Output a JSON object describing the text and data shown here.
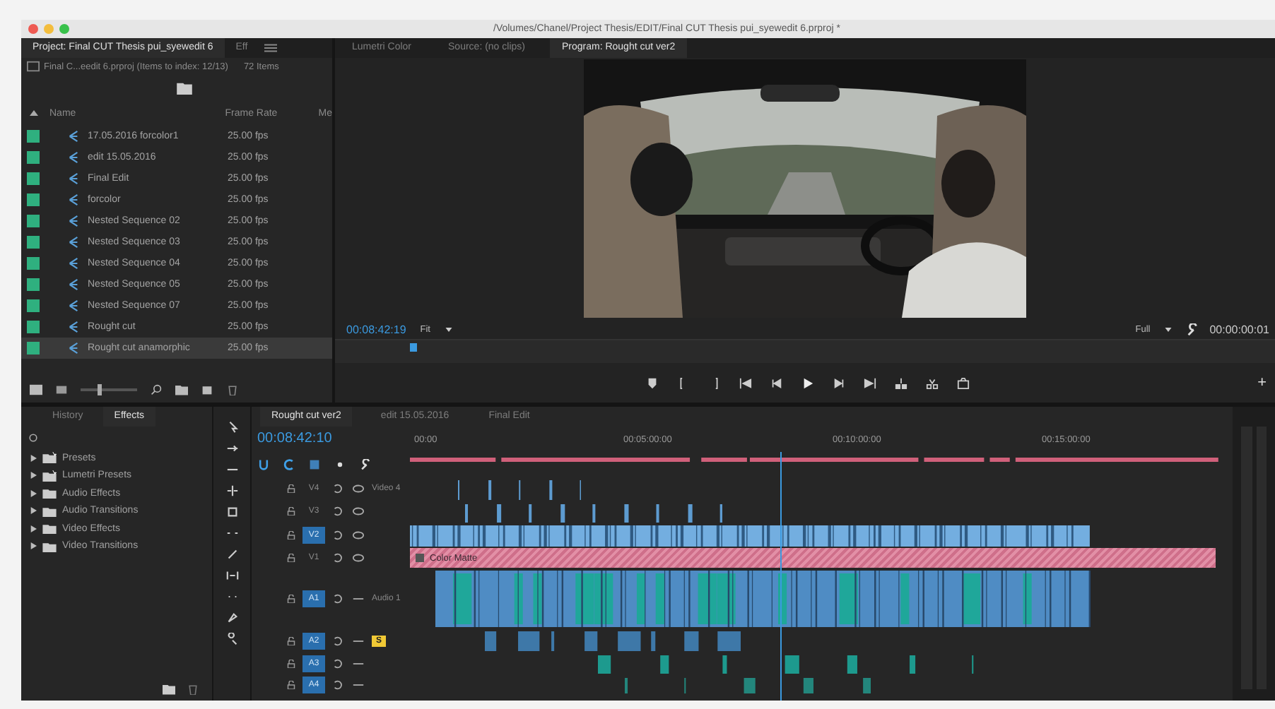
{
  "window": {
    "title": "/Volumes/Chanel/Project Thesis/EDIT/Final CUT Thesis pui_syewedit 6.prproj *"
  },
  "project_panel": {
    "tabs": [
      {
        "label": "Project: Final CUT Thesis pui_syewedit 6",
        "selected": true
      },
      {
        "label": "Eff",
        "selected": false
      }
    ],
    "path": "Final C...eedit 6.prproj (Items to index: 12/13)",
    "zoom_slider": {
      "level": 0.3
    },
    "item_count": "72 Items",
    "columns": [
      "Name",
      "Frame Rate",
      "Me"
    ],
    "rows": [
      {
        "name": "17.05.2016 forcolor1",
        "frame_rate": "25.00 fps",
        "selected": false
      },
      {
        "name": "edit 15.05.2016",
        "frame_rate": "25.00 fps",
        "selected": false
      },
      {
        "name": "Final Edit",
        "frame_rate": "25.00 fps",
        "selected": false
      },
      {
        "name": "forcolor",
        "frame_rate": "25.00 fps",
        "selected": false
      },
      {
        "name": "Nested Sequence 02",
        "frame_rate": "25.00 fps",
        "selected": false
      },
      {
        "name": "Nested Sequence 03",
        "frame_rate": "25.00 fps",
        "selected": false
      },
      {
        "name": "Nested Sequence 04",
        "frame_rate": "25.00 fps",
        "selected": false
      },
      {
        "name": "Nested Sequence 05",
        "frame_rate": "25.00 fps",
        "selected": false
      },
      {
        "name": "Nested Sequence 07",
        "frame_rate": "25.00 fps",
        "selected": false
      },
      {
        "name": "Rought cut",
        "frame_rate": "25.00 fps",
        "selected": false
      },
      {
        "name": "Rought cut anamorphic",
        "frame_rate": "25.00 fps",
        "selected": true
      }
    ]
  },
  "monitor": {
    "tabs": [
      {
        "label": "Lumetri Color",
        "selected": false
      },
      {
        "label": "Source: (no clips)",
        "selected": false
      },
      {
        "label": "Program: Rought cut ver2",
        "selected": true
      }
    ],
    "timecode": "00:08:42:19",
    "zoom": "Fit",
    "quality": "Full",
    "duration": "00:00:00:01",
    "scrub": {
      "level": 0.08
    },
    "add_button": "+"
  },
  "effects_panel": {
    "tabs": [
      {
        "label": "History",
        "selected": false
      },
      {
        "label": "Effects",
        "selected": true
      }
    ],
    "items": [
      {
        "label": "Presets",
        "kind": "presets",
        "expanded": false
      },
      {
        "label": "Lumetri Presets",
        "kind": "presets",
        "expanded": false
      },
      {
        "label": "Audio Effects",
        "kind": "folder",
        "expanded": false
      },
      {
        "label": "Audio Transitions",
        "kind": "folder",
        "expanded": false
      },
      {
        "label": "Video Effects",
        "kind": "folder",
        "expanded": false
      },
      {
        "label": "Video Transitions",
        "kind": "folder",
        "expanded": false
      }
    ]
  },
  "timeline": {
    "tabs": [
      {
        "label": "Rought cut ver2",
        "selected": true
      },
      {
        "label": "edit 15.05.2016",
        "selected": false
      },
      {
        "label": "Final Edit",
        "selected": false
      }
    ],
    "timecode": "00:08:42:10",
    "ruler": [
      "00:00",
      "00:05:00:00",
      "00:10:00:00",
      "00:15:00:00"
    ],
    "playhead": {
      "level": 0.45
    },
    "tracks": [
      {
        "label": "V4",
        "name": "Video 4",
        "kind": "video",
        "targeted": false
      },
      {
        "label": "V3",
        "kind": "video",
        "targeted": false
      },
      {
        "label": "V2",
        "kind": "video",
        "targeted": true
      },
      {
        "label": "V1",
        "kind": "video",
        "targeted": false,
        "clip": {
          "label": "Color Matte"
        }
      },
      {
        "label": "A1",
        "name": "Audio 1",
        "kind": "audio",
        "targeted": true
      },
      {
        "label": "A2",
        "kind": "audio",
        "targeted": true,
        "solo": {
          "label": "S",
          "on": true
        }
      },
      {
        "label": "A3",
        "kind": "audio",
        "targeted": true
      },
      {
        "label": "A4",
        "kind": "audio",
        "targeted": true
      }
    ]
  }
}
